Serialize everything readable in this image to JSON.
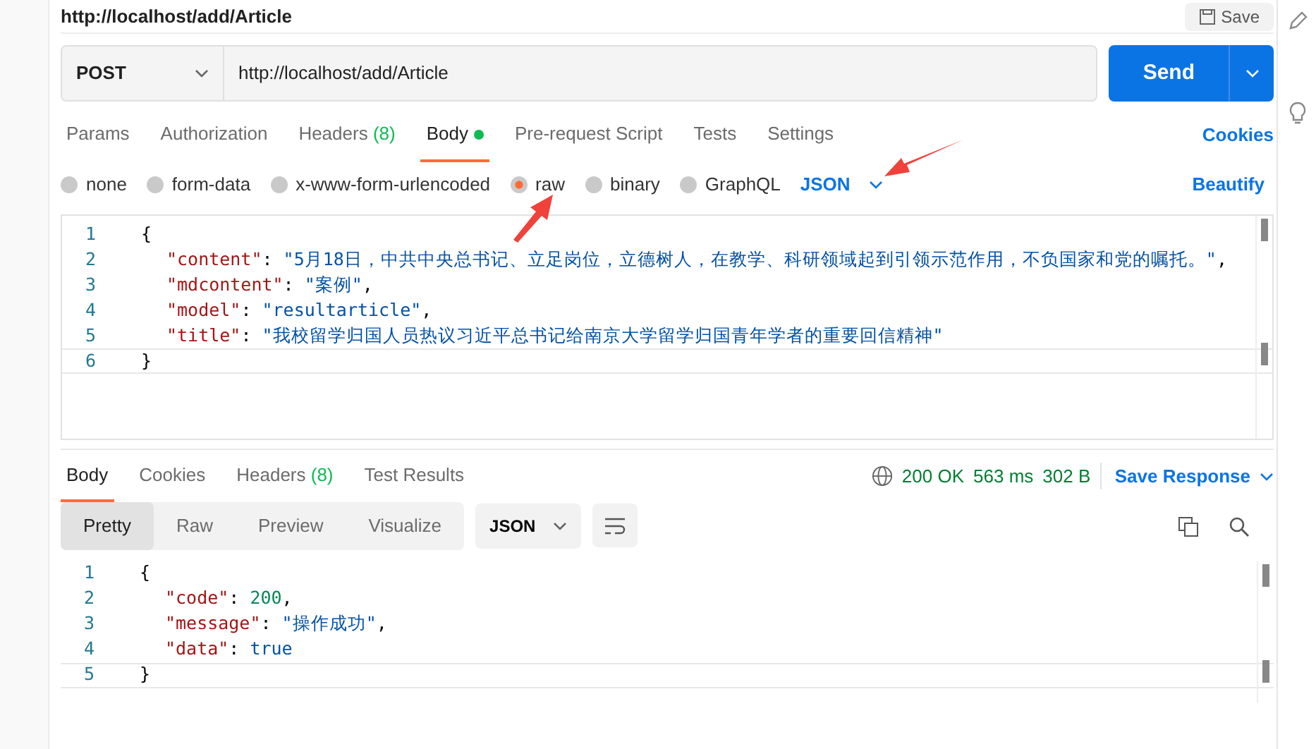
{
  "request_name": "http://localhost/add/Article",
  "save_button": {
    "label": "Save"
  },
  "method": "POST",
  "url": "http://localhost/add/Article",
  "send_button": {
    "label": "Send"
  },
  "request_tabs": [
    {
      "label": "Params",
      "selected": false
    },
    {
      "label": "Authorization",
      "selected": false
    },
    {
      "label": "Headers",
      "count": "(8)",
      "selected": false
    },
    {
      "label": "Body",
      "dot": true,
      "selected": true
    },
    {
      "label": "Pre-request Script",
      "selected": false
    },
    {
      "label": "Tests",
      "selected": false
    },
    {
      "label": "Settings",
      "selected": false
    }
  ],
  "cookies_link": "Cookies",
  "body_types": [
    {
      "label": "none",
      "selected": false
    },
    {
      "label": "form-data",
      "selected": false
    },
    {
      "label": "x-www-form-urlencoded",
      "selected": false
    },
    {
      "label": "raw",
      "selected": true
    },
    {
      "label": "binary",
      "selected": false
    },
    {
      "label": "GraphQL",
      "selected": false
    }
  ],
  "format": "JSON",
  "beautify_link": "Beautify",
  "request_body": [
    {
      "number": "1",
      "tokens": [
        {
          "kind": "punct",
          "text": "{"
        }
      ]
    },
    {
      "number": "2",
      "tokens": [
        {
          "kind": "key",
          "text": "\"content\""
        },
        {
          "kind": "punct",
          "text": ": "
        },
        {
          "kind": "string",
          "text": "\"5月18日，中共中央总书记、立足岗位，立德树人，在教学、科研领域起到引领示范作用，不负国家和党的嘱托。\""
        },
        {
          "kind": "punct",
          "text": ","
        }
      ]
    },
    {
      "number": "3",
      "tokens": [
        {
          "kind": "key",
          "text": "\"mdcontent\""
        },
        {
          "kind": "punct",
          "text": ": "
        },
        {
          "kind": "string",
          "text": "\"案例\""
        },
        {
          "kind": "punct",
          "text": ","
        }
      ]
    },
    {
      "number": "4",
      "tokens": [
        {
          "kind": "key",
          "text": "\"model\""
        },
        {
          "kind": "punct",
          "text": ": "
        },
        {
          "kind": "string",
          "text": "\"resultarticle\""
        },
        {
          "kind": "punct",
          "text": ","
        }
      ]
    },
    {
      "number": "5",
      "tokens": [
        {
          "kind": "key",
          "text": "\"title\""
        },
        {
          "kind": "punct",
          "text": ": "
        },
        {
          "kind": "string",
          "text": "\"我校留学归国人员热议习近平总书记给南京大学留学归国青年学者的重要回信精神\""
        }
      ]
    },
    {
      "number": "6",
      "tokens": [
        {
          "kind": "punct",
          "text": "}"
        }
      ]
    }
  ],
  "response_tabs": [
    {
      "label": "Body",
      "selected": true
    },
    {
      "label": "Cookies",
      "selected": false
    },
    {
      "label": "Headers",
      "count": "(8)",
      "selected": false
    },
    {
      "label": "Test Results",
      "selected": false
    }
  ],
  "status": "200 OK",
  "time": "563 ms",
  "size": "302 B",
  "save_response": "Save Response",
  "view_modes": [
    {
      "label": "Pretty",
      "selected": true
    },
    {
      "label": "Raw",
      "selected": false
    },
    {
      "label": "Preview",
      "selected": false
    },
    {
      "label": "Visualize",
      "selected": false
    }
  ],
  "response_format": "JSON",
  "response_body": [
    {
      "number": "1",
      "tokens": [
        {
          "kind": "punct",
          "text": "{"
        }
      ]
    },
    {
      "number": "2",
      "tokens": [
        {
          "kind": "key",
          "text": "\"code\""
        },
        {
          "kind": "punct",
          "text": ": "
        },
        {
          "kind": "number",
          "text": "200"
        },
        {
          "kind": "punct",
          "text": ","
        }
      ]
    },
    {
      "number": "3",
      "tokens": [
        {
          "kind": "key",
          "text": "\"message\""
        },
        {
          "kind": "punct",
          "text": ": "
        },
        {
          "kind": "string",
          "text": "\"操作成功\""
        },
        {
          "kind": "punct",
          "text": ","
        }
      ]
    },
    {
      "number": "4",
      "tokens": [
        {
          "kind": "key",
          "text": "\"data\""
        },
        {
          "kind": "punct",
          "text": ": "
        },
        {
          "kind": "bool",
          "text": "true"
        }
      ]
    },
    {
      "number": "5",
      "tokens": [
        {
          "kind": "punct",
          "text": "}"
        }
      ]
    }
  ]
}
